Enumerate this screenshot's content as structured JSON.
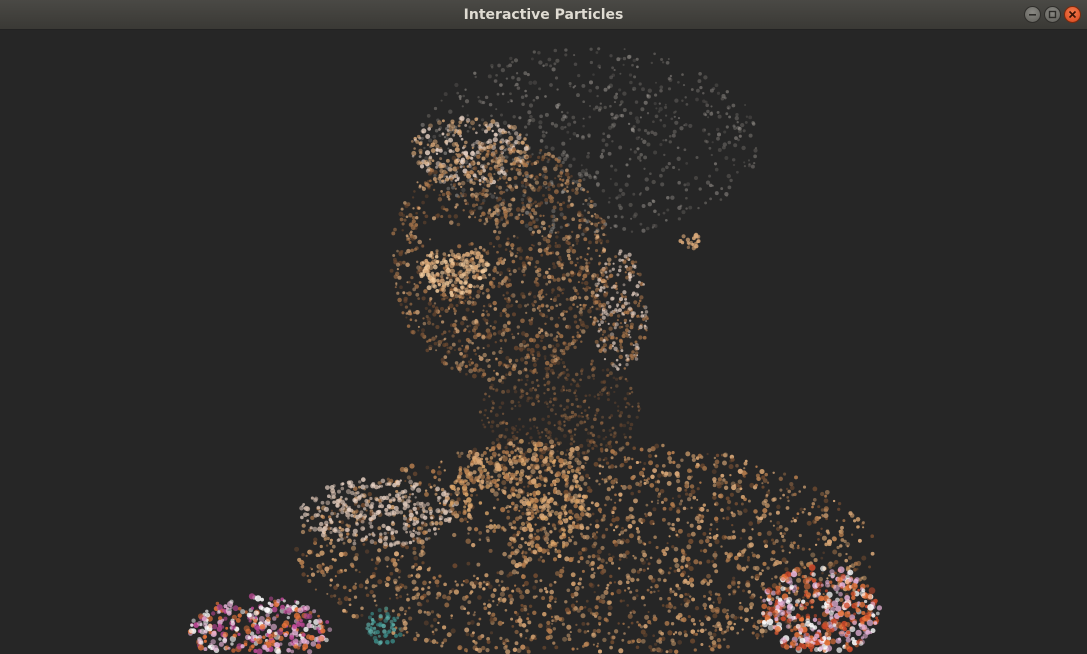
{
  "window": {
    "title": "Interactive Particles",
    "controls": {
      "minimize": "minimize-icon",
      "maximize": "maximize-icon",
      "close": "close-icon"
    }
  },
  "canvas": {
    "background": "#262626",
    "subject": "particle portrait"
  },
  "colors": {
    "skin_light": "#d9a878",
    "skin_mid": "#b07a4c",
    "skin_dark": "#6e4a30",
    "highlight": "#e8d2c4",
    "hair": "#8a8580",
    "pink": "#e8b4d8",
    "orange": "#e8743a",
    "teal": "#3a8a86"
  }
}
